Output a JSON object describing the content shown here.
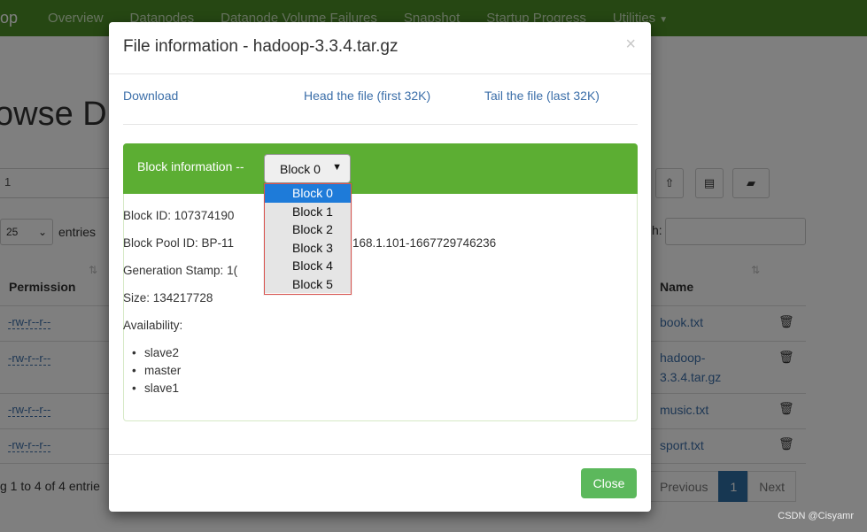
{
  "navbar": {
    "brand": "op",
    "items": [
      "Overview",
      "Datanodes",
      "Datanode Volume Failures",
      "Snapshot",
      "Startup Progress",
      "Utilities"
    ]
  },
  "page": {
    "title": "owse Di",
    "path_value": "1",
    "entries_value": "25",
    "entries_label": "entries",
    "search_label": "h:",
    "columns": {
      "permission": "Permission",
      "name": "Name"
    },
    "rows": [
      {
        "permission": "-rw-r--r--",
        "name": "book.txt"
      },
      {
        "permission": "-rw-r--r--",
        "name": "hadoop-3.3.4.tar.gz"
      },
      {
        "permission": "-rw-r--r--",
        "name": "music.txt"
      },
      {
        "permission": "-rw-r--r--",
        "name": "sport.txt"
      }
    ],
    "showing": "g 1 to 4 of 4 entrie",
    "pager": {
      "previous": "Previous",
      "current": "1",
      "next": "Next"
    }
  },
  "modal": {
    "title": "File information - hadoop-3.3.4.tar.gz",
    "close_x": "×",
    "links": {
      "download": "Download",
      "head": "Head the file (first 32K)",
      "tail": "Tail the file (last 32K)"
    },
    "panel_title": "Block information --",
    "block_select": "Block 0",
    "block_options": [
      "Block 0",
      "Block 1",
      "Block 2",
      "Block 3",
      "Block 4",
      "Block 5"
    ],
    "info": {
      "block_id": "Block ID: 107374190",
      "block_pool": "Block Pool ID: BP-11",
      "block_pool_tail": "168.1.101-1667729746236",
      "generation": "Generation Stamp: 1(",
      "size": "Size: 134217728",
      "availability": "Availability:"
    },
    "availability": [
      "slave2",
      "master",
      "slave1"
    ],
    "close_button": "Close"
  },
  "watermark": "CSDN @Cisyamr",
  "colors": {
    "navbar": "#4c8f26",
    "panel_header": "#5cae33",
    "close_button": "#5cb85c",
    "selected_option": "#1e7bd9",
    "link": "#3c6fa9"
  }
}
